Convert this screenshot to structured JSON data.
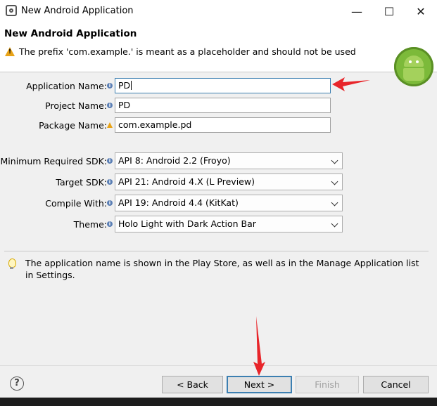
{
  "window": {
    "title": "New Android Application",
    "controls": {
      "minimize": "—",
      "maximize": "☐",
      "close": "✕"
    }
  },
  "header": {
    "title": "New Android Application",
    "warning": "The prefix 'com.example.' is meant as a placeholder and should not be used"
  },
  "form": {
    "application_name": {
      "label": "Application Name:",
      "value": "PD"
    },
    "project_name": {
      "label": "Project Name:",
      "value": "PD"
    },
    "package_name": {
      "label": "Package Name:",
      "value": "com.example.pd"
    },
    "min_sdk": {
      "label": "Minimum Required SDK:",
      "value": "API 8: Android 2.2 (Froyo)"
    },
    "target_sdk": {
      "label": "Target SDK:",
      "value": "API 21: Android 4.X (L Preview)"
    },
    "compile_with": {
      "label": "Compile With:",
      "value": "API 19: Android 4.4 (KitKat)"
    },
    "theme": {
      "label": "Theme:",
      "value": "Holo Light with Dark Action Bar"
    }
  },
  "hint": "The application name is shown in the Play Store, as well as in the Manage Application list in Settings.",
  "footer": {
    "help": "?",
    "back": "< Back",
    "next": "Next >",
    "finish": "Finish",
    "cancel": "Cancel"
  },
  "colors": {
    "accent": "#3c7fb1",
    "warning": "#e8a317",
    "annotation_arrow": "#e8252a",
    "android_green": "#7cba3a"
  }
}
